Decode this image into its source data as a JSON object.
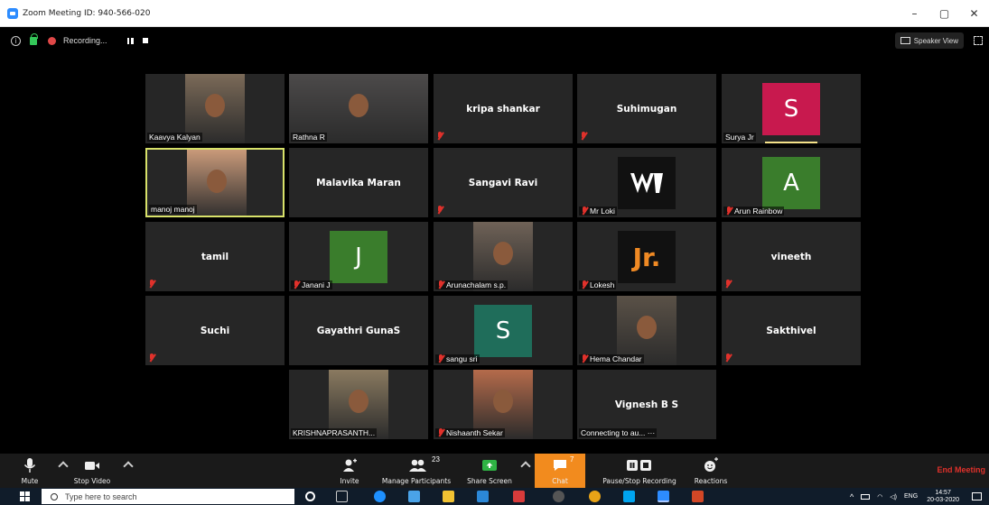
{
  "window": {
    "title": "Zoom Meeting ID: 940-566-020",
    "controls": [
      "–",
      "▢",
      "✕"
    ]
  },
  "status": {
    "recording_label": "Recording...",
    "speaker_view_label": "Speaker View"
  },
  "participants": [
    {
      "name": "Kaavya Kalyan",
      "type": "video",
      "muted": false
    },
    {
      "name": "Rathna R",
      "type": "video",
      "muted": false
    },
    {
      "name": "kripa shankar",
      "type": "name",
      "muted": true
    },
    {
      "name": "Suhimugan",
      "type": "name",
      "muted": true
    },
    {
      "name": "Surya Jr",
      "type": "avatar",
      "letter": "S",
      "color": "#c8194e",
      "muted": false
    },
    {
      "name": "manoj manoj",
      "type": "video",
      "muted": false,
      "active": true
    },
    {
      "name": "Malavika Maran",
      "type": "name",
      "muted": false
    },
    {
      "name": "Sangavi Ravi",
      "type": "name",
      "muted": true
    },
    {
      "name": "Mr Loki",
      "type": "logo",
      "muted": true
    },
    {
      "name": "Arun Rainbow",
      "type": "avatar",
      "letter": "A",
      "color": "#3a7d2c",
      "muted": true
    },
    {
      "name": "tamil",
      "type": "name",
      "muted": true
    },
    {
      "name": "Janani J",
      "type": "avatar",
      "letter": "J",
      "color": "#3a7d2c",
      "muted": true
    },
    {
      "name": "Arunachalam s.p.",
      "type": "video",
      "muted": true
    },
    {
      "name": "Lokesh",
      "type": "avatar-jr",
      "letter": "Jr.",
      "color": "#111111",
      "muted": true
    },
    {
      "name": "vineeth",
      "type": "name",
      "muted": true
    },
    {
      "name": "Suchi",
      "type": "name",
      "muted": true
    },
    {
      "name": "Gayathri GunaS",
      "type": "name",
      "muted": false
    },
    {
      "name": "sangu sri",
      "type": "avatar",
      "letter": "S",
      "color": "#1f6d5a",
      "muted": true
    },
    {
      "name": "Hema Chandar",
      "type": "video",
      "muted": true
    },
    {
      "name": "Sakthivel",
      "type": "name",
      "muted": true
    },
    {
      "name": "KRISHNAPRASANTH...",
      "type": "video",
      "muted": false
    },
    {
      "name": "Nishaanth Sekar",
      "type": "video",
      "muted": true
    },
    {
      "name": "Vignesh B S",
      "type": "connecting",
      "muted": false,
      "status": "Connecting to au... ···"
    }
  ],
  "toolbar": {
    "mute": "Mute",
    "stop_video": "Stop Video",
    "invite": "Invite",
    "manage_participants": "Manage Participants",
    "participants_count": "23",
    "share_screen": "Share Screen",
    "chat": "Chat",
    "chat_count": "7",
    "pause_recording": "Pause/Stop Recording",
    "reactions": "Reactions",
    "end_meeting": "End Meeting"
  },
  "taskbar": {
    "search_placeholder": "Type here to search",
    "lang": "ENG",
    "time": "14:57",
    "date": "20-03-2020"
  }
}
